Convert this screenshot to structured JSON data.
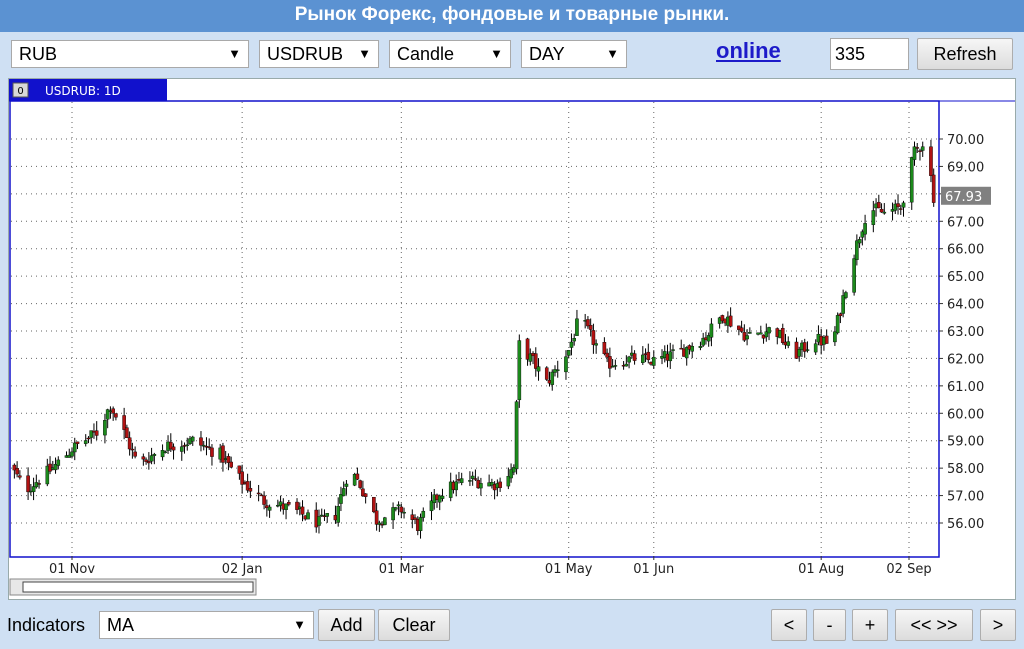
{
  "header": {
    "title": "Рынок Форекс, фондовые и товарные рынки."
  },
  "toolbar": {
    "market_select": "RUB",
    "symbol_select": "USDRUB",
    "chart_type_select": "Candle",
    "period_select": "DAY",
    "online_link": "online",
    "bars_input": "335",
    "refresh_label": "Refresh"
  },
  "bottom": {
    "indicators_label": "Indicators",
    "indicator_select": "MA",
    "add_label": "Add",
    "clear_label": "Clear",
    "nav_buttons": [
      "<",
      "-",
      "+",
      "<< >>",
      ">"
    ]
  },
  "chart_data": {
    "type": "candlestick",
    "tab_label": "USDRUB: 1D",
    "tab_index": "0",
    "y_ticks": [
      "70.00",
      "69.00",
      "68.00",
      "67.00",
      "66.00",
      "65.00",
      "64.00",
      "63.00",
      "62.00",
      "61.00",
      "60.00",
      "59.00",
      "58.00",
      "57.00",
      "56.00"
    ],
    "x_ticks": [
      "01 Nov",
      "02 Jan",
      "01 Mar",
      "01 May",
      "01 Jun",
      "01 Aug",
      "02 Sep"
    ],
    "last_price": "67.93",
    "ylim": [
      55.0,
      71.0
    ],
    "grid": true,
    "colors": {
      "up": "#1c8a1c",
      "down": "#b01212",
      "price_tag": "#808080"
    },
    "approx_close_path": [
      [
        "2017-10-10",
        58.0
      ],
      [
        "2017-10-15",
        57.2
      ],
      [
        "2017-10-25",
        58.0
      ],
      [
        "2017-11-01",
        58.7
      ],
      [
        "2017-11-10",
        59.3
      ],
      [
        "2017-11-15",
        60.3
      ],
      [
        "2017-11-20",
        59.3
      ],
      [
        "2017-11-25",
        58.1
      ],
      [
        "2017-12-05",
        58.8
      ],
      [
        "2017-12-15",
        59.0
      ],
      [
        "2017-12-25",
        58.5
      ],
      [
        "2018-01-01",
        57.6
      ],
      [
        "2018-01-10",
        56.8
      ],
      [
        "2018-01-20",
        56.5
      ],
      [
        "2018-01-30",
        56.0
      ],
      [
        "2018-02-05",
        56.3
      ],
      [
        "2018-02-10",
        58.0
      ],
      [
        "2018-02-14",
        57.4
      ],
      [
        "2018-02-20",
        56.1
      ],
      [
        "2018-03-01",
        56.5
      ],
      [
        "2018-03-07",
        55.9
      ],
      [
        "2018-03-15",
        57.1
      ],
      [
        "2018-03-25",
        57.6
      ],
      [
        "2018-04-05",
        57.4
      ],
      [
        "2018-04-11",
        58.0
      ],
      [
        "2018-04-13",
        62.5
      ],
      [
        "2018-04-18",
        61.9
      ],
      [
        "2018-04-23",
        61.1
      ],
      [
        "2018-05-01",
        62.3
      ],
      [
        "2018-05-05",
        63.5
      ],
      [
        "2018-05-15",
        61.8
      ],
      [
        "2018-05-25",
        62.0
      ],
      [
        "2018-06-01",
        61.9
      ],
      [
        "2018-06-10",
        62.2
      ],
      [
        "2018-06-20",
        62.8
      ],
      [
        "2018-06-26",
        63.6
      ],
      [
        "2018-07-05",
        62.8
      ],
      [
        "2018-07-15",
        63.1
      ],
      [
        "2018-07-22",
        62.1
      ],
      [
        "2018-07-30",
        62.7
      ],
      [
        "2018-08-05",
        62.5
      ],
      [
        "2018-08-12",
        65.5
      ],
      [
        "2018-08-18",
        67.5
      ],
      [
        "2018-08-24",
        67.3
      ],
      [
        "2018-08-30",
        67.5
      ],
      [
        "2018-09-04",
        69.5
      ],
      [
        "2018-09-08",
        70.0
      ],
      [
        "2018-09-11",
        67.9
      ]
    ]
  }
}
